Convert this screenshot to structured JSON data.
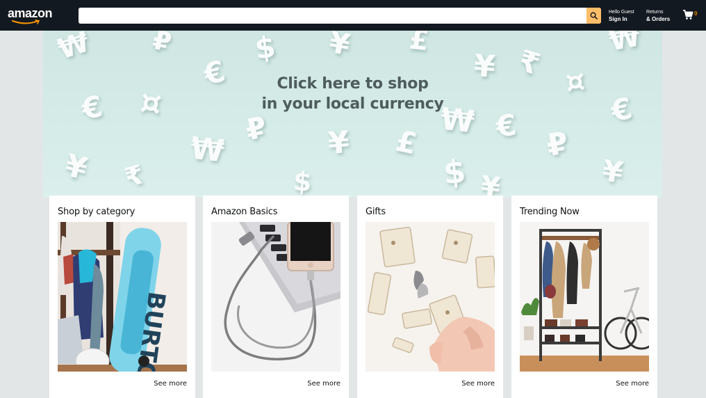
{
  "header": {
    "logo": "amazon",
    "search": {
      "value": "",
      "placeholder": ""
    },
    "account": {
      "greeting": "Hello Guest",
      "action": "Sign In"
    },
    "returns": {
      "line1": "Returns",
      "line2": "& Orders"
    },
    "cart": {
      "count": "0",
      "icon": "cart-icon"
    }
  },
  "hero": {
    "line1": "Click here to shop",
    "line2": "in your local currency"
  },
  "cards": [
    {
      "title": "Shop by category",
      "link": "See more"
    },
    {
      "title": "Amazon Basics",
      "link": "See more"
    },
    {
      "title": "Gifts",
      "link": "See more"
    },
    {
      "title": "Trending Now",
      "link": "See more"
    }
  ],
  "colors": {
    "header_bg": "#131921",
    "search_button": "#febd69",
    "cart_count": "#f08804",
    "hero_bg": "#d5ece8",
    "page_bg": "#e3e6e6"
  }
}
